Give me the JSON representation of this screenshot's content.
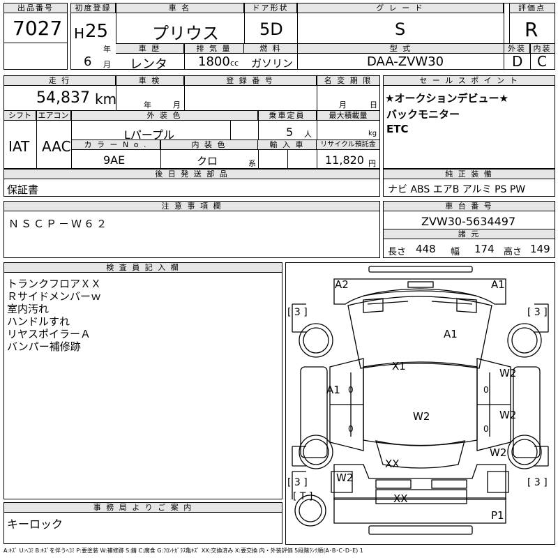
{
  "top": {
    "lot_label": "出品番号",
    "lot_no": "7027",
    "first_reg_label": "初度登録",
    "era": "H",
    "year": "25",
    "year_unit": "年",
    "month": "6",
    "month_unit": "月",
    "car_name_label": "車 名",
    "car_name": "プリウス",
    "door_label": "ドア形状",
    "door": "5D",
    "grade_label": "グ レ ー ド",
    "grade": "S",
    "rating_label": "評価点",
    "rating": "R",
    "history_label": "車 歴",
    "history": "レンタ",
    "displacement_label": "排 気 量",
    "displacement": "1800",
    "displacement_unit": "cc",
    "fuel_label": "燃 料",
    "fuel": "ガソリン",
    "model_label": "型 式",
    "model": "DAA-ZVW30",
    "ext_label": "外装",
    "ext_grade": "D",
    "int_label": "内装",
    "int_grade": "C"
  },
  "mid": {
    "mileage_label": "走 行",
    "mileage": "54,837",
    "mileage_unit": "km",
    "inspection_label": "車 検",
    "insp_year": "年",
    "insp_month": "月",
    "reg_label": "登 録 番 号",
    "name_change_label": "名 変 期 限",
    "nc_month": "月",
    "nc_day": "日",
    "shift_label": "シフト",
    "shift": "IAT",
    "ac_label": "エアコン",
    "ac": "AAC",
    "ext_color_label": "外 装 色",
    "ext_color": "Lパープル",
    "capacity_label": "乗車定員",
    "capacity": "5",
    "capacity_unit": "人",
    "load_label": "最大積載量",
    "load_unit": "kg",
    "color_no_label": "カ ラ ー  N o .",
    "color_no": "9AE",
    "int_color_label": "内 装 色",
    "int_color": "クロ",
    "int_color_unit": "系",
    "import_label": "輸 入 車",
    "recycle_label": "リサイクル預託金",
    "recycle": "11,820",
    "recycle_unit": "円"
  },
  "sales": {
    "label": "セ ー ル ス ポ イ ン ト",
    "lines": [
      "★オークションデビュー★",
      "バックモニター",
      "ETC"
    ]
  },
  "later_parts": {
    "label": "後 日 発 送 部 品",
    "value": "保証書"
  },
  "genuine": {
    "label": "純 正 装 備",
    "value": "ナビ ABS エアB アルミ PS PW"
  },
  "notes": {
    "label": "注 意 事 項 欄",
    "value": "ＮＳＣＰ－Ｗ６２"
  },
  "chassis": {
    "label": "車 台 番 号",
    "value": "ZVW30-5634497"
  },
  "specs": {
    "label": "諸 元",
    "length_label": "長さ",
    "length": "448",
    "width_label": "幅",
    "width": "174",
    "height_label": "高さ",
    "height": "149"
  },
  "inspector": {
    "label": "検 査 員 記 入 欄",
    "lines": [
      "トランクフロアＸＸ",
      "Ｒサイドメンバーｗ",
      "室内汚れ",
      "ハンドルすれ",
      "リヤスポイラーＡ",
      "バンパー補修跡"
    ]
  },
  "office": {
    "label": "事 務 局 よ り ご 案 内",
    "value": "キーロック"
  },
  "diagram": {
    "A2": "A2",
    "A1_top": "A1",
    "A1_center": "A1",
    "X1": "X1",
    "A1_left": "A1",
    "W2_right1": "W2",
    "W2_right2": "W2",
    "W2_right3": "W2",
    "W2_center": "W2",
    "XX_rear": "XX",
    "W2_left": "W2",
    "XX_bottom": "XX",
    "P1": "P1",
    "bracket_tl": "[ 3 ]",
    "bracket_tr": "[ 3 ]",
    "bracket_bl": "[ 3 ]",
    "bracket_br": "[ 3 ]",
    "bracket_t": "[ T ]",
    "zero_l1": "0",
    "zero_l2": "0",
    "zero_r1": "0",
    "zero_r2": "0"
  },
  "legend": "A:ｷｽﾞ U:ﾍｺﾐ B:ｷｽﾞを伴うﾍｺﾐ P:要塗装 W:補修跡 S:錆 C:腐食 G:ﾌﾛﾝﾄｶﾞﾗｽ亀ｷｽﾞ XX:交換済み X:要交換 内・外装評価 5段階ﾗﾝｸ順(A･B･C･D･E) 1"
}
